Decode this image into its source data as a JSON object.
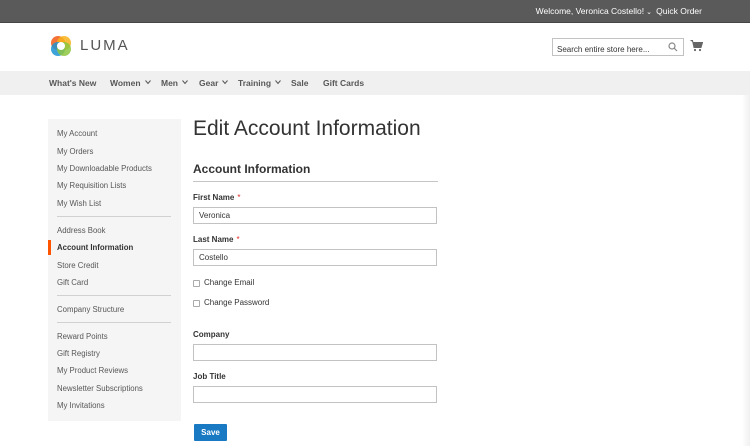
{
  "topbar": {
    "welcome": "Welcome, Veronica Costello!",
    "quick_order": "Quick Order"
  },
  "header": {
    "logo_text": "LUMA",
    "search_placeholder": "Search entire store here..."
  },
  "nav": {
    "items": [
      {
        "label": "What's New",
        "has_dropdown": false
      },
      {
        "label": "Women",
        "has_dropdown": true
      },
      {
        "label": "Men",
        "has_dropdown": true
      },
      {
        "label": "Gear",
        "has_dropdown": true
      },
      {
        "label": "Training",
        "has_dropdown": true
      },
      {
        "label": "Sale",
        "has_dropdown": false
      },
      {
        "label": "Gift Cards",
        "has_dropdown": false
      }
    ]
  },
  "sidebar": {
    "groups": [
      [
        "My Account",
        "My Orders",
        "My Downloadable Products",
        "My Requisition Lists",
        "My Wish List"
      ],
      [
        "Address Book",
        "Account Information",
        "Store Credit",
        "Gift Card"
      ],
      [
        "Company Structure"
      ],
      [
        "Reward Points",
        "Gift Registry",
        "My Product Reviews",
        "Newsletter Subscriptions",
        "My Invitations"
      ]
    ],
    "active": "Account Information"
  },
  "main": {
    "title": "Edit Account Information",
    "section_title": "Account Information",
    "first_name": {
      "label": "First Name",
      "value": "Veronica"
    },
    "last_name": {
      "label": "Last Name",
      "value": "Costello"
    },
    "change_email": "Change Email",
    "change_password": "Change Password",
    "company": {
      "label": "Company",
      "value": ""
    },
    "job_title": {
      "label": "Job Title",
      "value": ""
    },
    "required_mark": "*",
    "save_label": "Save"
  },
  "colors": {
    "accent": "#1979c3",
    "active_bar": "#ff5501",
    "required": "#e02b27",
    "topbar": "#5a5a5a"
  }
}
